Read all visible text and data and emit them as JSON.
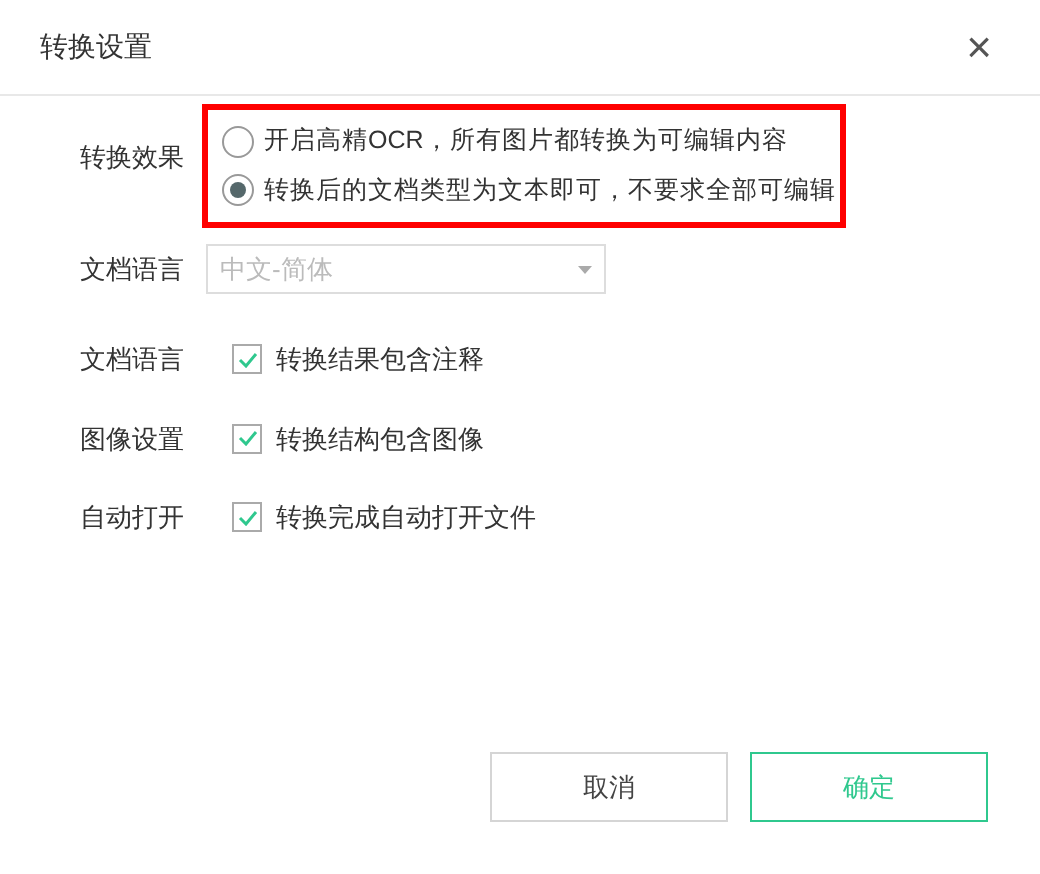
{
  "dialog": {
    "title": "转换设置",
    "close": "×"
  },
  "effect": {
    "label": "转换效果",
    "options": [
      {
        "label": "开启高精OCR，所有图片都转换为可编辑内容",
        "selected": false
      },
      {
        "label": "转换后的文档类型为文本即可，不要求全部可编辑",
        "selected": true
      }
    ]
  },
  "language": {
    "label": "文档语言",
    "value": "中文-简体",
    "disabled": true
  },
  "checks": [
    {
      "label": "文档语言",
      "text": "转换结果包含注释",
      "checked": true
    },
    {
      "label": "图像设置",
      "text": "转换结构包含图像",
      "checked": true
    },
    {
      "label": "自动打开",
      "text": "转换完成自动打开文件",
      "checked": true
    }
  ],
  "buttons": [
    {
      "label": "取消",
      "kind": "secondary"
    },
    {
      "label": "确定",
      "kind": "primary"
    }
  ]
}
